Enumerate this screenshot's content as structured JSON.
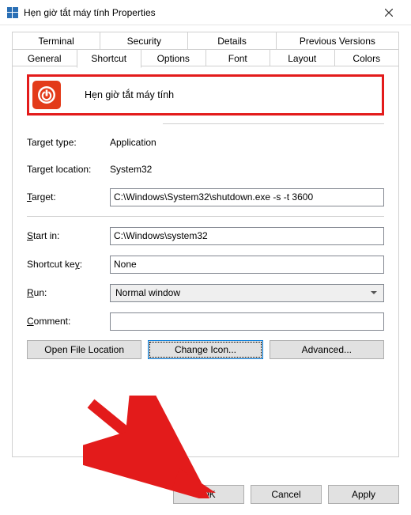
{
  "window": {
    "title": "Hẹn giờ tắt máy tính Properties"
  },
  "tabs_row1": {
    "t0": "Terminal",
    "t1": "Security",
    "t2": "Details",
    "t3": "Previous Versions"
  },
  "tabs_row2": {
    "t0": "General",
    "t1": "Shortcut",
    "t2": "Options",
    "t3": "Font",
    "t4": "Layout",
    "t5": "Colors"
  },
  "shortcut": {
    "name": "Hẹn giờ tắt máy tính",
    "target_type_label": "Target type:",
    "target_type": "Application",
    "target_location_label": "Target location:",
    "target_location": "System32",
    "target_label_pre": "T",
    "target_label_post": "arget:",
    "target": "C:\\Windows\\System32\\shutdown.exe -s -t 3600",
    "startin_label_pre": "S",
    "startin_label_post": "tart in:",
    "start_in": "C:\\Windows\\system32",
    "shortcutkey_label": "Shortcut ke",
    "shortcutkey_label_ul": "y",
    "shortcutkey_label_post": ":",
    "shortcut_key": "None",
    "run_label_pre": "R",
    "run_label_post": "un:",
    "run": "Normal window",
    "comment_label_pre": "C",
    "comment_label_post": "omment:",
    "comment": ""
  },
  "buttons": {
    "open_file_location": "Open File Location",
    "change_icon": "Change Icon...",
    "advanced": "Advanced..."
  },
  "dialog": {
    "ok": "OK",
    "cancel": "Cancel",
    "apply": "Apply"
  }
}
